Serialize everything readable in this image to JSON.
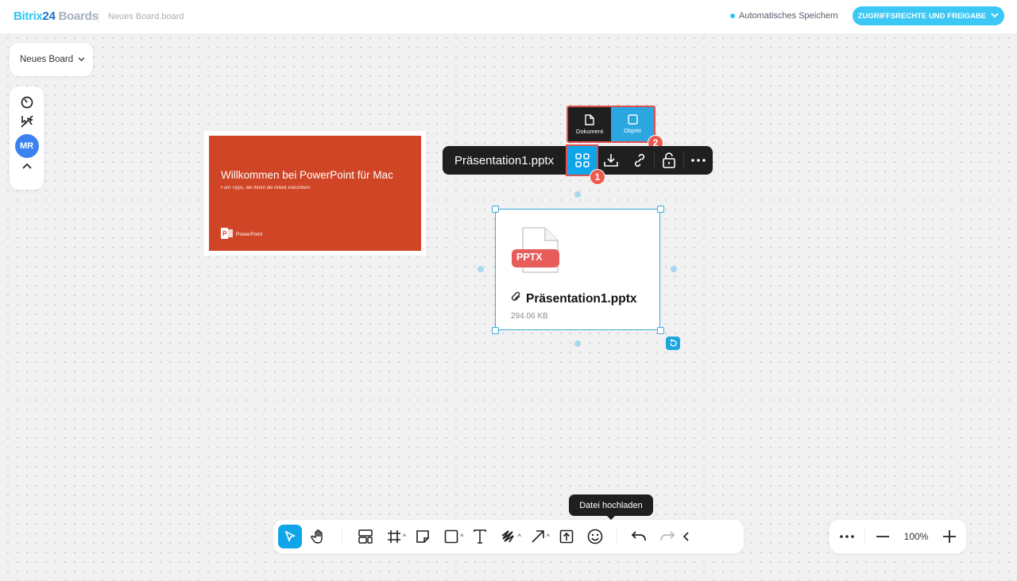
{
  "header": {
    "logo_brand": "Bitrix",
    "logo_num": "24",
    "logo_product": "Boards",
    "board_file": "Neues Board.board",
    "autosave": "Automatisches Speichern",
    "share_button": "ZUGRIFFSRECHTE UND FREIGABE"
  },
  "board_menu": {
    "label": "Neues Board"
  },
  "left_tools": {
    "avatar": "MR"
  },
  "slide": {
    "title": "Willkommen bei PowerPoint für Mac",
    "subtitle": "Fünf Tipps, die Ihnen die Arbeit erleichtern",
    "brand": "PowerPoint"
  },
  "file_toolbar": {
    "filename": "Präsentation1.pptx",
    "badge1": "1",
    "badge2": "2"
  },
  "view_popup": {
    "document": "Dokument",
    "object": "Objekt"
  },
  "file_card": {
    "ext": "PPTX",
    "name": "Präsentation1.pptx",
    "size": "294.06 KB"
  },
  "tooltip": "Datei hochladen",
  "zoom": {
    "level": "100%"
  },
  "colors": {
    "accent": "#0ea5e9",
    "share": "#3bc8f5",
    "slide": "#d04525",
    "badge": "#ec5a4f"
  }
}
